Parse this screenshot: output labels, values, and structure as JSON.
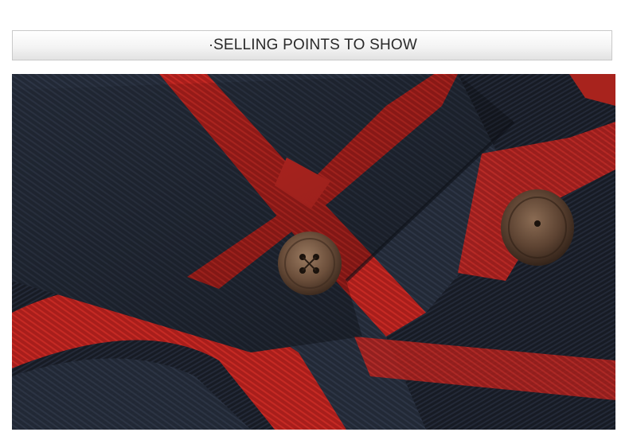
{
  "header": {
    "title": "SELLING POINTS TO SHOW"
  },
  "photo": {
    "subject": "close-up of red and navy plaid flannel shirt collar with buttons",
    "colors": {
      "navy": "#1f2633",
      "red": "#b3201c",
      "button": "#6b4f3a"
    }
  }
}
